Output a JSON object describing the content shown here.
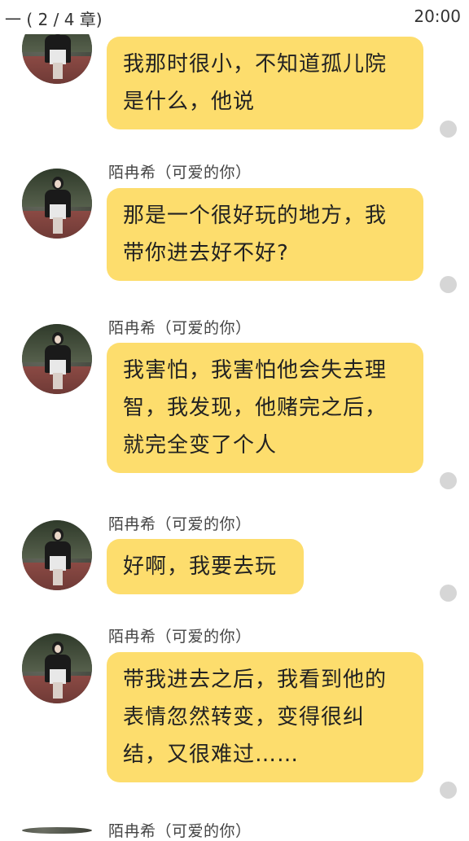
{
  "status_bar": {
    "chapter": "一 ( 2 / 4 章)",
    "time": "20:00"
  },
  "messages": [
    {
      "sender": "",
      "text": "我那时很小，不知道孤儿院是什么，他说"
    },
    {
      "sender": "陌冉希（可爱的你）",
      "text": "那是一个很好玩的地方，我带你进去好不好?"
    },
    {
      "sender": "陌冉希（可爱的你）",
      "text": "我害怕，我害怕他会失去理智，我发现，他赌完之后，就完全变了个人"
    },
    {
      "sender": "陌冉希（可爱的你）",
      "text": "好啊，我要去玩"
    },
    {
      "sender": "陌冉希（可爱的你）",
      "text": "带我进去之后，我看到他的表情忽然转变，变得很纠结，又很难过……"
    },
    {
      "sender": "陌冉希（可爱的你）",
      "text": ""
    }
  ],
  "colors": {
    "bubble": "#fddd6d",
    "read_dot": "#d6d6d6",
    "background": "#ffffff"
  },
  "icons": {
    "avatar": "girl-avatar-icon",
    "status_dot": "read-status-dot-icon"
  }
}
